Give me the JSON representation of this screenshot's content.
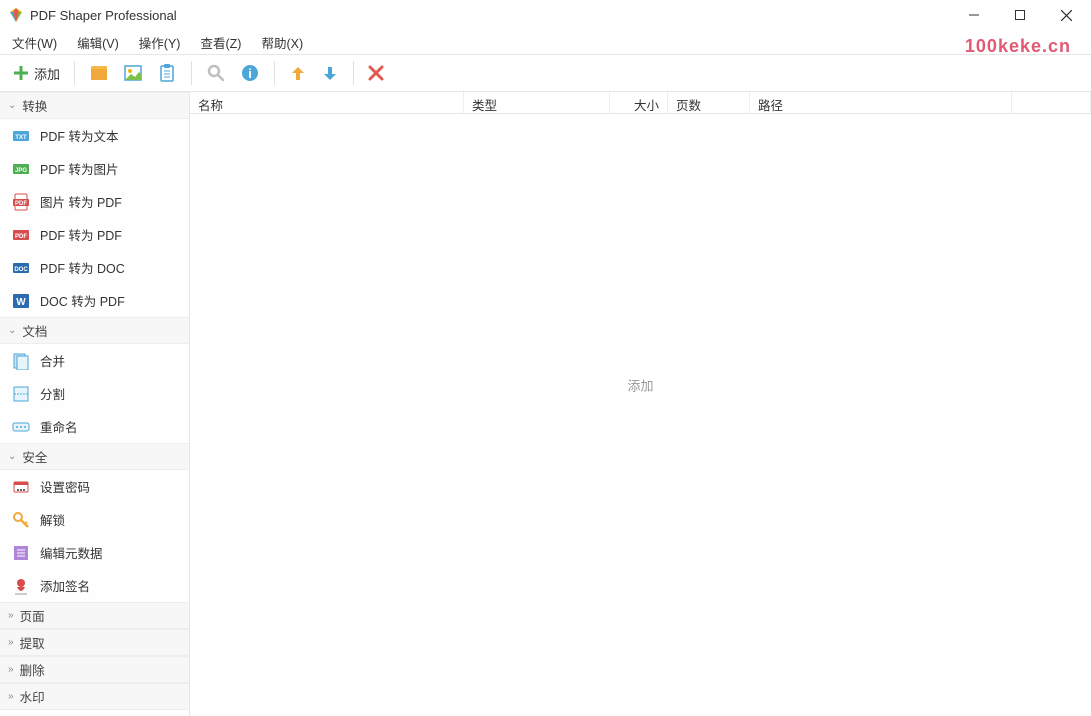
{
  "window": {
    "title": "PDF Shaper Professional"
  },
  "menubar": {
    "file": "文件(W)",
    "edit": "编辑(V)",
    "action": "操作(Y)",
    "view": "查看(Z)",
    "help": "帮助(X)"
  },
  "watermark": "100keke.cn",
  "toolbar": {
    "add": "添加"
  },
  "sidebar": {
    "sections": {
      "convert": {
        "title": "转换",
        "items": [
          "PDF 转为文本",
          "PDF 转为图片",
          "图片 转为 PDF",
          "PDF 转为 PDF",
          "PDF 转为 DOC",
          "DOC 转为 PDF"
        ]
      },
      "document": {
        "title": "文档",
        "items": [
          "合并",
          "分割",
          "重命名"
        ]
      },
      "security": {
        "title": "安全",
        "items": [
          "设置密码",
          "解锁",
          "编辑元数据",
          "添加签名"
        ]
      },
      "page": {
        "title": "页面"
      },
      "extract": {
        "title": "提取"
      },
      "delete": {
        "title": "删除"
      },
      "watermark": {
        "title": "水印"
      }
    }
  },
  "columns": {
    "name": "名称",
    "type": "类型",
    "size": "大小",
    "pages": "页数",
    "path": "路径"
  },
  "filearea": {
    "placeholder": "添加"
  }
}
